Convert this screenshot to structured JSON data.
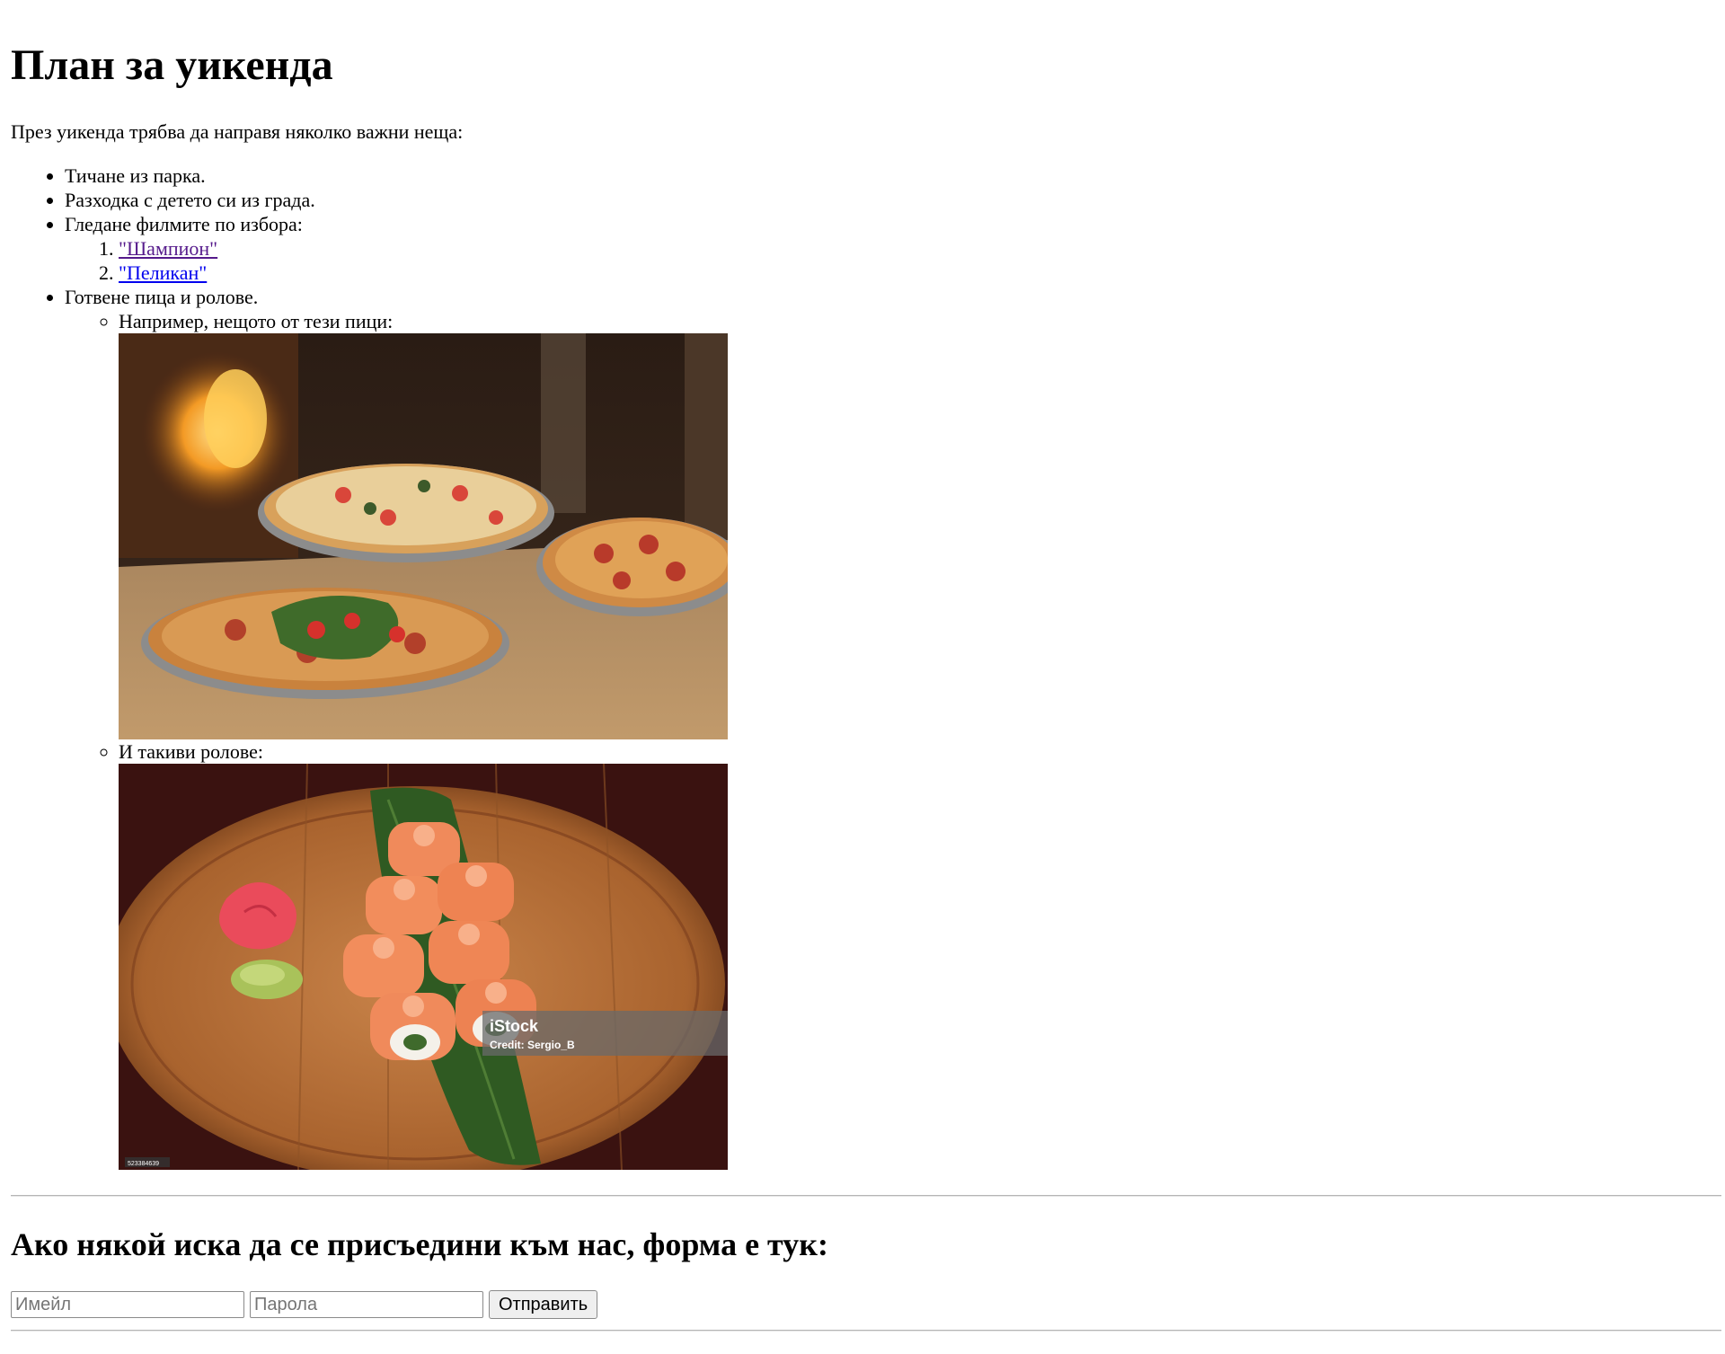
{
  "page": {
    "title": "План за уикенда",
    "intro": "През уикенда трябва да направя няколко важни неща:"
  },
  "plan": {
    "items": [
      {
        "label": "Тичане из парка."
      },
      {
        "label": "Разходка с детето си из града."
      },
      {
        "label": "Гледане филмите по избора:"
      },
      {
        "label": "Готвене пица и ролове."
      }
    ],
    "films": [
      {
        "label": "\"Шампион\"",
        "visited": true
      },
      {
        "label": "\"Пеликан\"",
        "visited": false
      }
    ],
    "food": [
      {
        "label": "Например, нещото от тези пици:",
        "image": "pizzas-photo"
      },
      {
        "label": "И такиви ролове:",
        "image": "sushi-rolls-photo"
      }
    ],
    "watermark": {
      "brand": "iStock",
      "credit": "Credit: Sergio_B",
      "stock_id": "523384639"
    }
  },
  "join": {
    "heading": "Ако някой иска да се присъедини към нас, форма е тук:",
    "email_placeholder": "Имейл",
    "password_placeholder": "Парола",
    "submit_label": "Отправить"
  },
  "colors": {
    "link": "#0000ee",
    "visited_link": "#551a8b"
  }
}
